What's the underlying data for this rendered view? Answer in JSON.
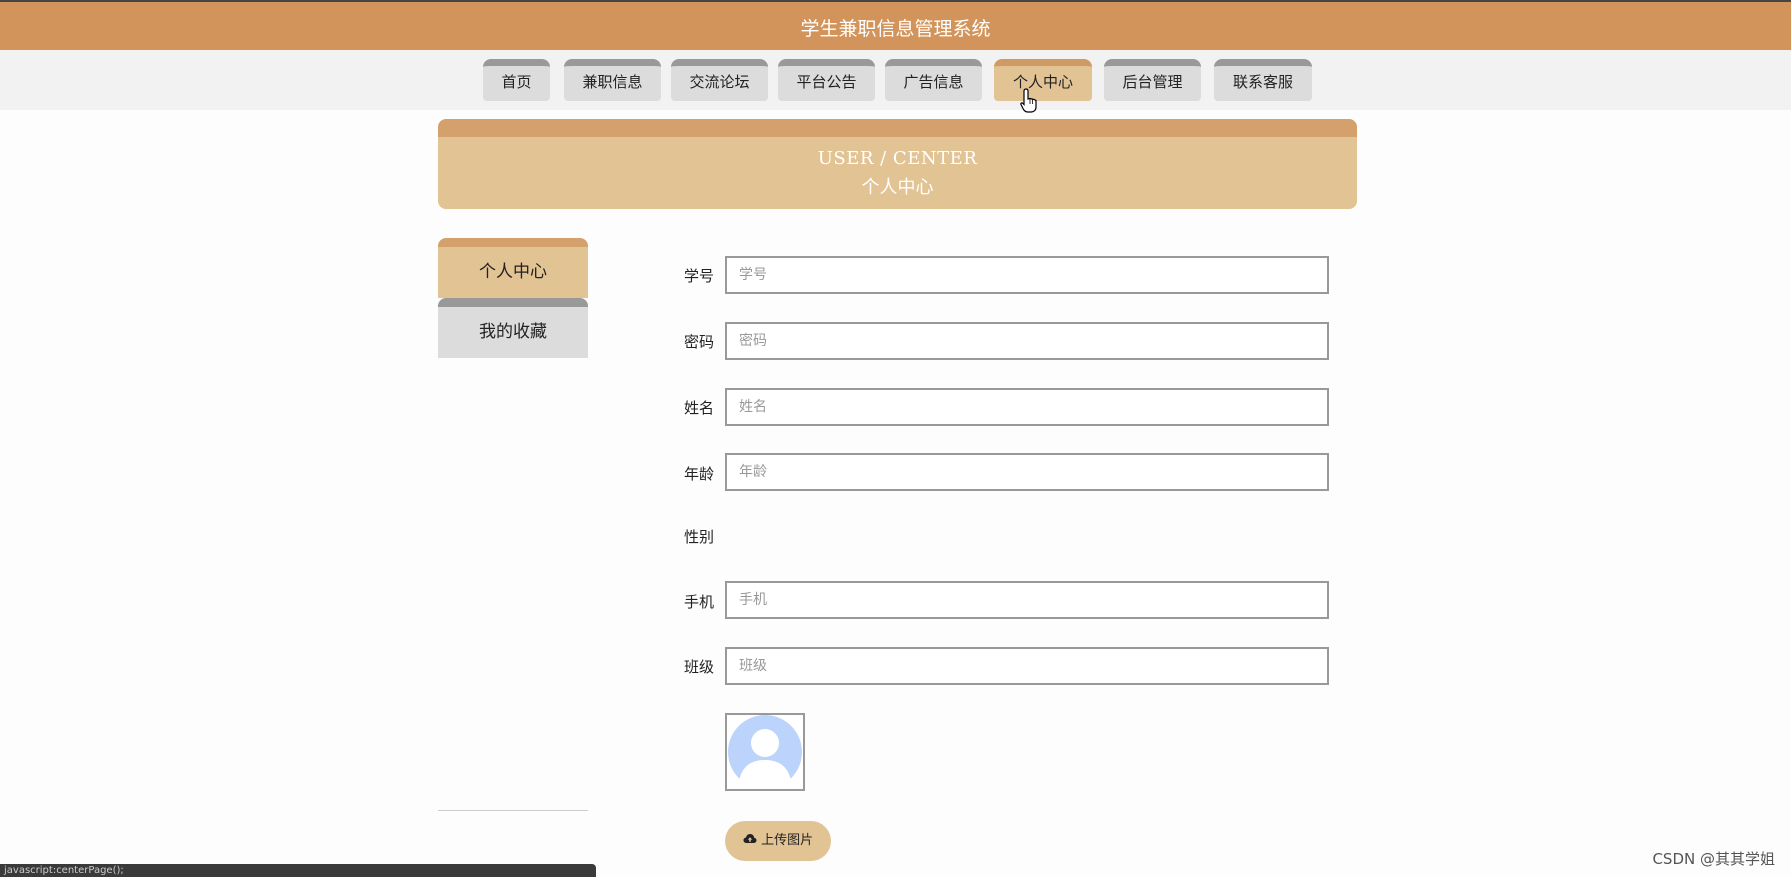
{
  "header": {
    "title": "学生兼职信息管理系统"
  },
  "nav": {
    "items": [
      {
        "label": "首页"
      },
      {
        "label": "兼职信息"
      },
      {
        "label": "交流论坛"
      },
      {
        "label": "平台公告"
      },
      {
        "label": "广告信息"
      },
      {
        "label": "个人中心",
        "active": true
      },
      {
        "label": "后台管理"
      },
      {
        "label": "联系客服"
      }
    ]
  },
  "banner": {
    "en": "USER / CENTER",
    "cn": "个人中心"
  },
  "sidebar": {
    "items": [
      {
        "label": "个人中心",
        "active": true
      },
      {
        "label": "我的收藏"
      }
    ]
  },
  "form": {
    "student_id": {
      "label": "学号",
      "placeholder": "学号",
      "value": ""
    },
    "password": {
      "label": "密码",
      "placeholder": "密码",
      "value": ""
    },
    "name": {
      "label": "姓名",
      "placeholder": "姓名",
      "value": ""
    },
    "age": {
      "label": "年龄",
      "placeholder": "年龄",
      "value": ""
    },
    "gender": {
      "label": "性别"
    },
    "phone": {
      "label": "手机",
      "placeholder": "手机",
      "value": ""
    },
    "class": {
      "label": "班级",
      "placeholder": "班级",
      "value": ""
    },
    "upload_label": "上传图片"
  },
  "status_bar": {
    "text": "javascript:centerPage();"
  },
  "watermark": "CSDN @其其学姐",
  "colors": {
    "header_bg": "#d2945a",
    "accent": "#e2c394",
    "inactive_tab": "#dcdcdc"
  }
}
